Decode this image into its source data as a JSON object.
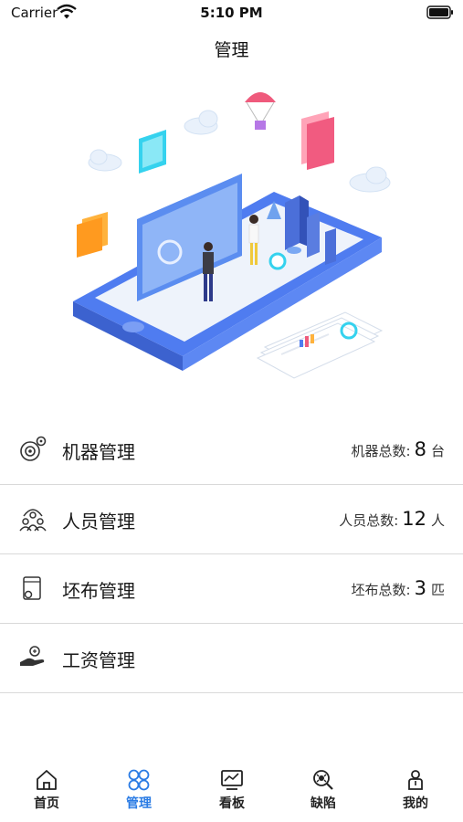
{
  "status_bar": {
    "carrier": "Carrier",
    "time": "5:10 PM"
  },
  "nav": {
    "title": "管理"
  },
  "rows": [
    {
      "label": "机器管理",
      "stat_prefix": "机器总数:",
      "stat_value": "8",
      "stat_unit": "台",
      "icon": "machine-gears-icon"
    },
    {
      "label": "人员管理",
      "stat_prefix": "人员总数:",
      "stat_value": "12",
      "stat_unit": "人",
      "icon": "people-group-icon"
    },
    {
      "label": "坯布管理",
      "stat_prefix": "坯布总数:",
      "stat_value": "3",
      "stat_unit": "匹",
      "icon": "fabric-roll-icon"
    },
    {
      "label": "工资管理",
      "icon": "salary-hand-icon"
    }
  ],
  "tabs": [
    {
      "label": "首页",
      "icon": "home-icon",
      "active": false
    },
    {
      "label": "管理",
      "icon": "manage-grid-icon",
      "active": true
    },
    {
      "label": "看板",
      "icon": "dashboard-monitor-icon",
      "active": false
    },
    {
      "label": "缺陷",
      "icon": "defect-search-icon",
      "active": false
    },
    {
      "label": "我的",
      "icon": "profile-icon",
      "active": false
    }
  ],
  "colors": {
    "accent": "#2a7be4",
    "divider": "#d9d9d9",
    "hero_blue": "#4f7cf0"
  }
}
